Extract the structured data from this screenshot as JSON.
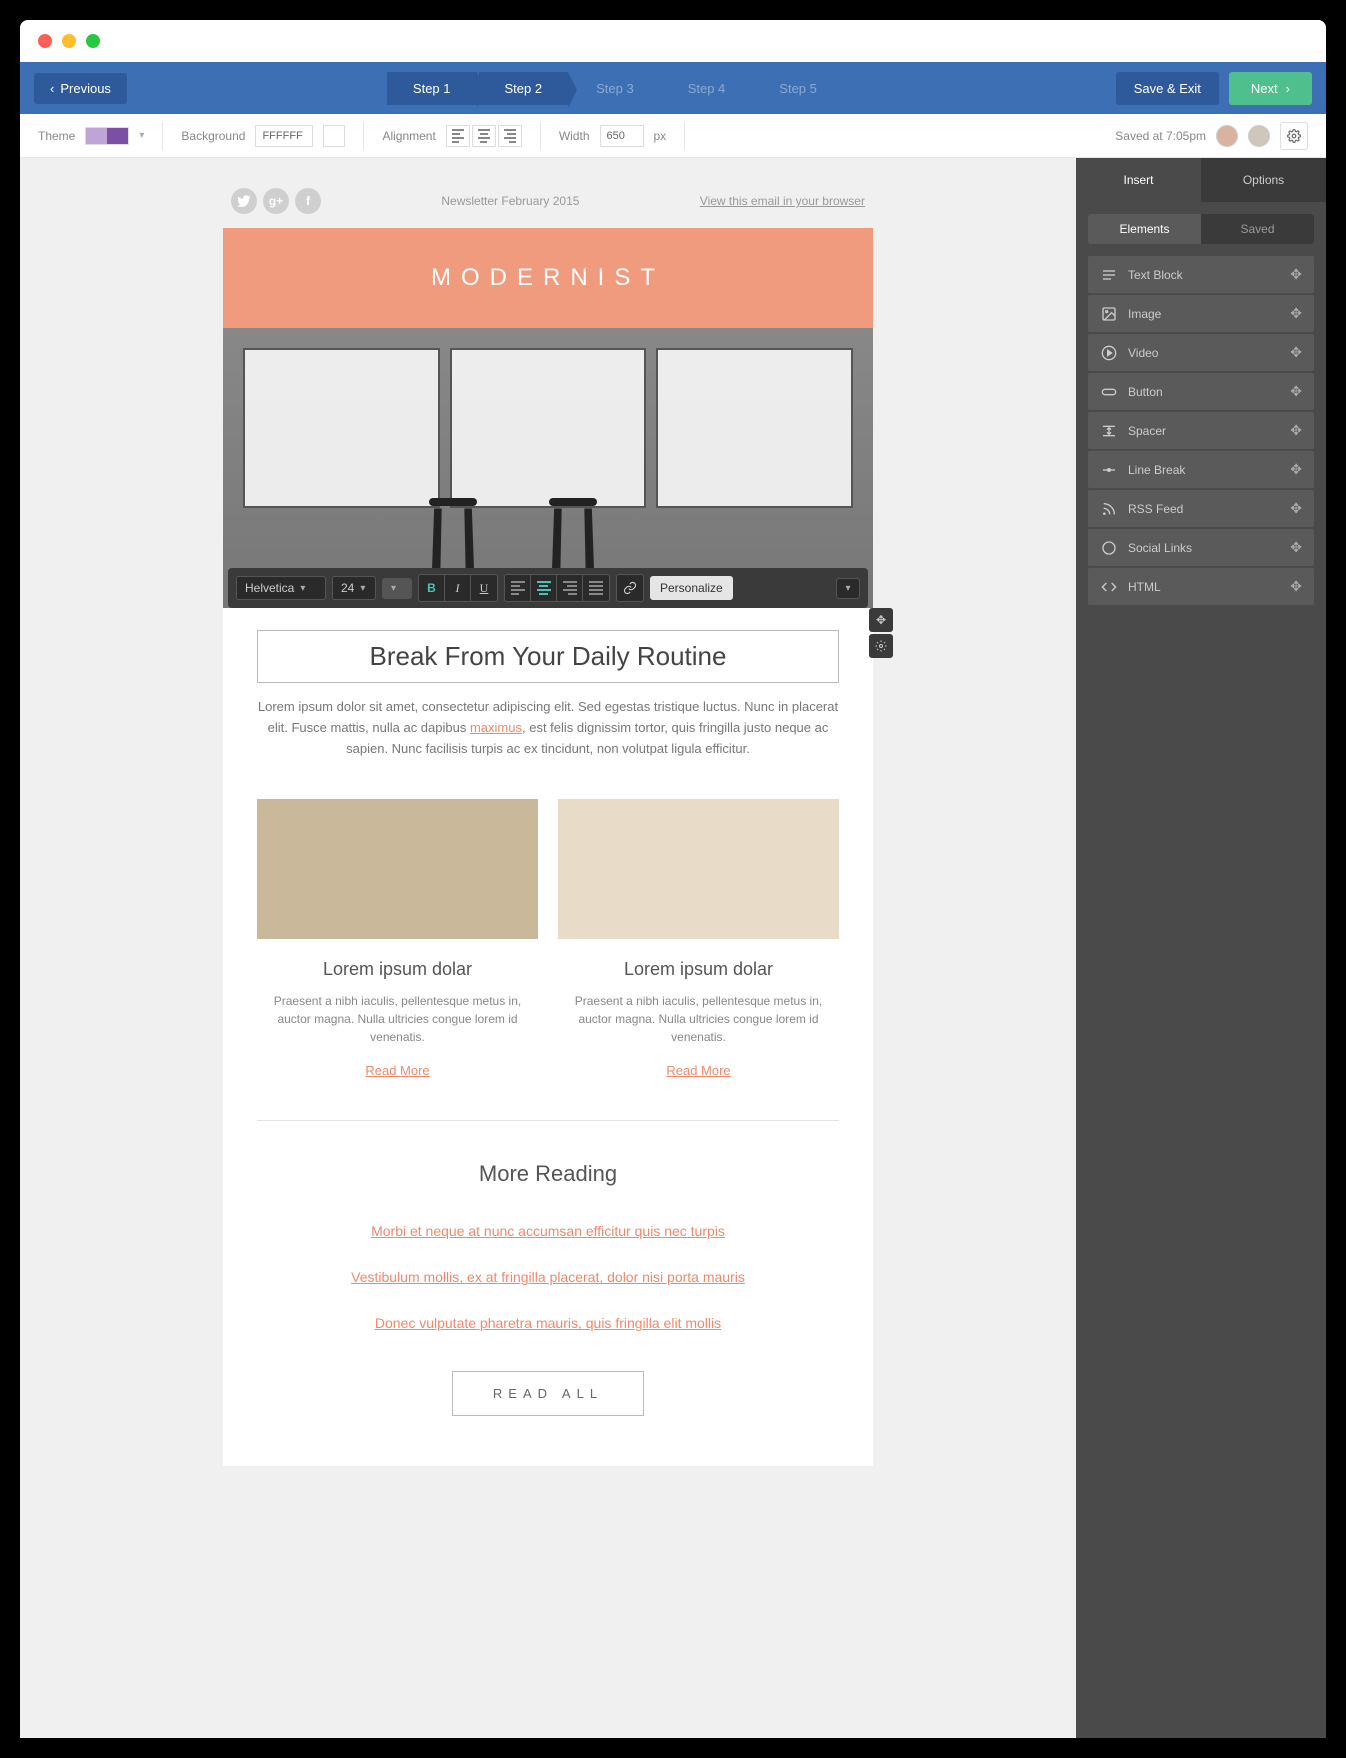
{
  "nav": {
    "previous": "Previous",
    "steps": [
      "Step 1",
      "Step 2",
      "Step 3",
      "Step 4",
      "Step 5"
    ],
    "save_exit": "Save & Exit",
    "next": "Next"
  },
  "toolbar": {
    "theme_label": "Theme",
    "background_label": "Background",
    "background_value": "FFFFFF",
    "alignment_label": "Alignment",
    "width_label": "Width",
    "width_value": "650",
    "width_unit": "px",
    "saved_text": "Saved at 7:05pm"
  },
  "email": {
    "preheader": "Newsletter February 2015",
    "view_browser": "View this email in your browser",
    "brand": "MODERNIST",
    "headline": "Break From Your Daily Routine",
    "body": "Lorem ipsum dolor sit amet, consectetur adipiscing elit. Sed egestas tristique luctus. Nunc in placerat elit. Fusce mattis, nulla ac dapibus ",
    "body_link": "maximus",
    "body2": ", est felis dignissim tortor, quis fringilla justo neque ac sapien. Nunc facilisis turpis ac ex tincidunt, non volutpat ligula efficitur.",
    "columns": [
      {
        "title": "Lorem ipsum dolar",
        "text": "Praesent a nibh iaculis, pellentesque metus in, auctor magna. Nulla ultricies congue lorem id venenatis.",
        "cta": "Read More"
      },
      {
        "title": "Lorem ipsum dolar",
        "text": "Praesent a nibh iaculis, pellentesque metus in, auctor magna. Nulla ultricies congue lorem id venenatis.",
        "cta": "Read More"
      }
    ],
    "more_heading": "More Reading",
    "more_links": [
      "Morbi et neque at nunc accumsan efficitur quis nec turpis",
      "Vestibulum mollis, ex at fringilla placerat, dolor nisi porta mauris",
      "Donec vulputate pharetra mauris, quis fringilla elit mollis"
    ],
    "read_all": "READ ALL"
  },
  "rte": {
    "font": "Helvetica",
    "size": "24",
    "personalize": "Personalize"
  },
  "sidebar": {
    "tabs": {
      "insert": "Insert",
      "options": "Options"
    },
    "subtabs": {
      "elements": "Elements",
      "saved": "Saved"
    },
    "elements": [
      "Text Block",
      "Image",
      "Video",
      "Button",
      "Spacer",
      "Line Break",
      "RSS Feed",
      "Social Links",
      "HTML"
    ]
  }
}
